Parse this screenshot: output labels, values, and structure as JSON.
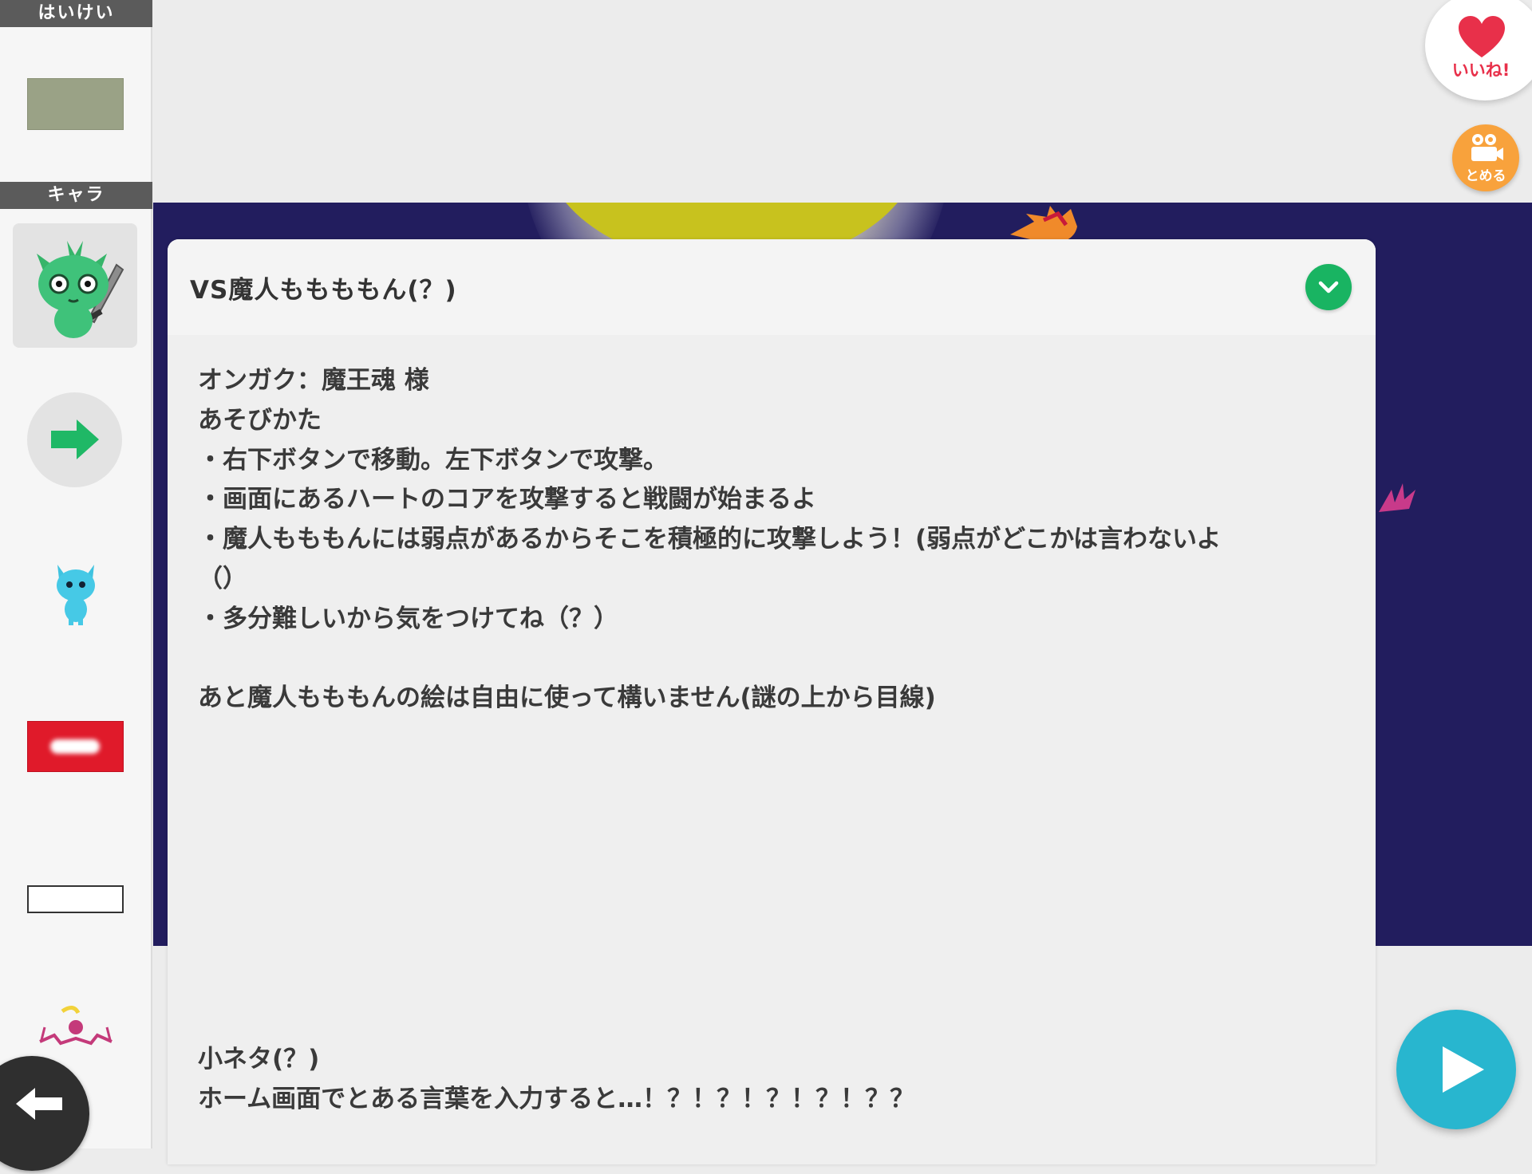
{
  "sidebar": {
    "background_label": "はいけい",
    "character_label": "キャラ",
    "thumbnails": [
      {
        "name": "background-thumbnail",
        "color": "#9aa286"
      },
      {
        "name": "green-knight-character",
        "selected": true
      },
      {
        "name": "green-arrow-character",
        "color": "#1fb866"
      },
      {
        "name": "blue-creature-character",
        "color": "#3fc3e0"
      },
      {
        "name": "red-bar-character",
        "color": "#e01a2a"
      },
      {
        "name": "white-bar-character",
        "color": "#ffffff"
      },
      {
        "name": "pink-creature-character",
        "color": "#c43a7a"
      }
    ]
  },
  "panel": {
    "title": "VS魔人ももももん(？)",
    "body": "オンガク：魔王魂 様\nあそびかた\n・右下ボタンで移動。左下ボタンで攻撃。\n・画面にあるハートのコアを攻撃すると戦闘が始まるよ\n・魔人もももんには弱点があるからそこを積極的に攻撃しよう！(弱点がどこかは言わないよ\n（）\n・多分難しいから気をつけてね（？）\n\nあと魔人もももんの絵は自由に使って構いません(謎の上から目線)",
    "footer_heading": "小ネタ(？)",
    "footer_text": "ホーム画面でとある言葉を入力すると…！？！？！？！？！？？"
  },
  "buttons": {
    "like_label": "いいね!",
    "stop_label": "とめる"
  },
  "colors": {
    "stage": "#221d5e",
    "accent_green": "#19b462",
    "play_blue": "#28b6cf",
    "like_red": "#e8304a",
    "stop_orange": "#f8a23c"
  }
}
